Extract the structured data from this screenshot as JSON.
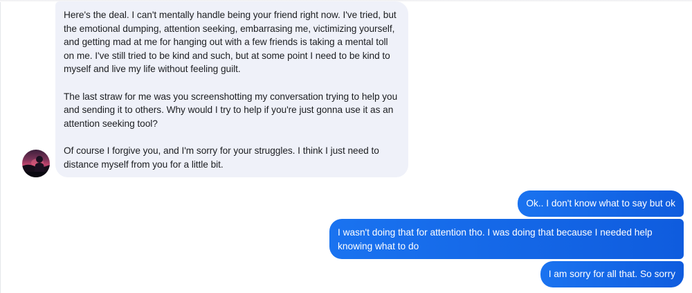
{
  "conversation": {
    "incoming_message": {
      "paragraphs": [
        "Here's the deal. I can't mentally handle being your friend right now. I've tried, but the emotional dumping, attention seeking, embarrasing me, victimizing yourself, and getting mad at me for hanging out with a few friends is taking a mental toll on me. I've still tried to be kind and such, but at some point I need to be kind to myself and live my life without feeling guilt.",
        "The last straw for me was you screenshotting my conversation trying to help you and sending it to others. Why would I try to help if you're just gonna use it as an attention seeking tool?",
        "Of course I forgive you, and I'm sorry for your struggles. I think I just need to distance myself from you for a little bit."
      ]
    },
    "outgoing_messages": [
      "Ok.. I don't know what to say but ok",
      "I wasn't doing that for attention tho. I was doing that because I needed help knowing what to do",
      "I am sorry for all that. So sorry"
    ]
  },
  "colors": {
    "incoming_bubble": "#eff1f9",
    "outgoing_bubble": "#1a73f0",
    "outgoing_bubble_end": "#0f5cde",
    "incoming_text": "#1c1e21",
    "outgoing_text": "#ffffff"
  }
}
